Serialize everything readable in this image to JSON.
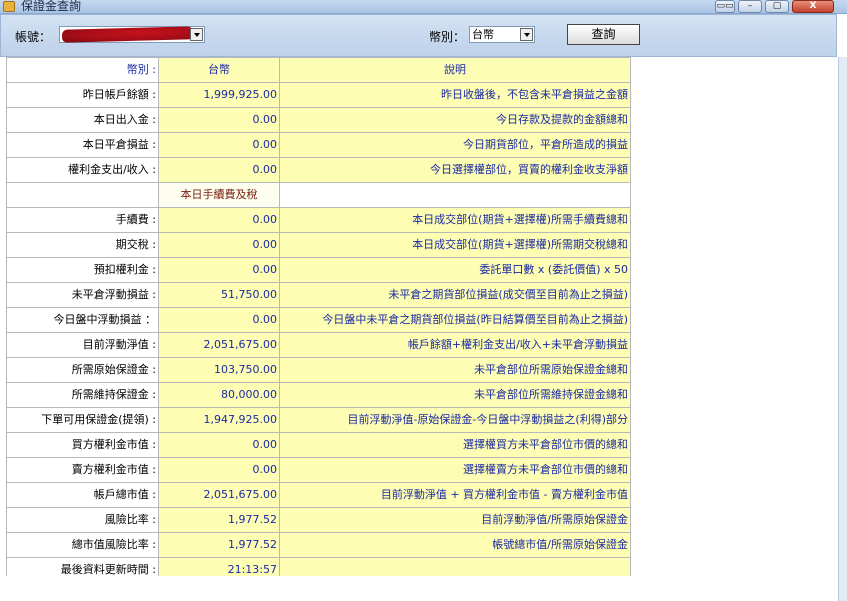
{
  "window": {
    "title": "保證金查詢",
    "buttons": {
      "restore": "▭▭",
      "minimize": "–",
      "maximize": "▢",
      "close": "X"
    }
  },
  "toolbar": {
    "account_label": "帳號：",
    "account_value_redacted": true,
    "currency_label": "幣別：",
    "currency_value": "台幣",
    "query_button": "查詢"
  },
  "table": {
    "header": {
      "label": "幣別 :",
      "value": "台幣",
      "desc": "說明"
    },
    "rows": [
      {
        "label": "昨日帳戶餘額 :",
        "value": "1,999,925.00",
        "desc": "昨日收盤後，不包含未平倉損益之金額"
      },
      {
        "label": "本日出入金 :",
        "value": "0.00",
        "desc": "今日存款及提款的金額總和"
      },
      {
        "label": "本日平倉損益 :",
        "value": "0.00",
        "desc": "今日期貨部位，平倉所造成的損益"
      },
      {
        "label": "權利金支出/收入 :",
        "value": "0.00",
        "desc": "今日選擇權部位，買賣的權利金收支淨額"
      }
    ],
    "section": "本日手續費及稅",
    "rows2": [
      {
        "label": "手續費 :",
        "value": "0.00",
        "desc": "本日成交部位(期貨+選擇權)所需手續費總和"
      },
      {
        "label": "期交稅 :",
        "value": "0.00",
        "desc": "本日成交部位(期貨+選擇權)所需期交稅總和"
      },
      {
        "label": "預扣權利金 :",
        "value": "0.00",
        "desc": "委託單口數 x (委託價值) x 50"
      },
      {
        "label": "未平倉浮動損益 :",
        "value": "51,750.00",
        "desc": "未平倉之期貨部位損益(成交價至目前為止之損益)"
      },
      {
        "label": "今日盤中浮動損益 ：",
        "value": "0.00",
        "desc": "今日盤中未平倉之期貨部位損益(昨日結算價至目前為止之損益)"
      },
      {
        "label": "目前浮動淨值 :",
        "value": "2,051,675.00",
        "desc": "帳戶餘額+權利金支出/收入+未平倉浮動損益"
      },
      {
        "label": "所需原始保證金 :",
        "value": "103,750.00",
        "desc": "未平倉部位所需原始保證金總和"
      },
      {
        "label": "所需維持保證金 :",
        "value": "80,000.00",
        "desc": "未平倉部位所需維持保證金總和"
      },
      {
        "label": "下單可用保證金(提領) :",
        "value": "1,947,925.00",
        "desc": "目前浮動淨值-原始保證金-今日盤中浮動損益之(利得)部分"
      },
      {
        "label": "買方權利金市值 :",
        "value": "0.00",
        "desc": "選擇權買方未平倉部位市價的總和"
      },
      {
        "label": "賣方權利金市值 :",
        "value": "0.00",
        "desc": "選擇權賣方未平倉部位市價的總和"
      },
      {
        "label": "帳戶總市值 :",
        "value": "2,051,675.00",
        "desc": "目前浮動淨值 + 買方權利金市值 - 賣方權利金市值"
      },
      {
        "label": "風險比率 :",
        "value": "1,977.52",
        "desc": "目前浮動淨值/所需原始保證金"
      },
      {
        "label": "總市值風險比率 :",
        "value": "1,977.52",
        "desc": "帳號總市值/所需原始保證金"
      },
      {
        "label": "最後資料更新時間 :",
        "value": "21:13:57",
        "desc": ""
      }
    ]
  }
}
